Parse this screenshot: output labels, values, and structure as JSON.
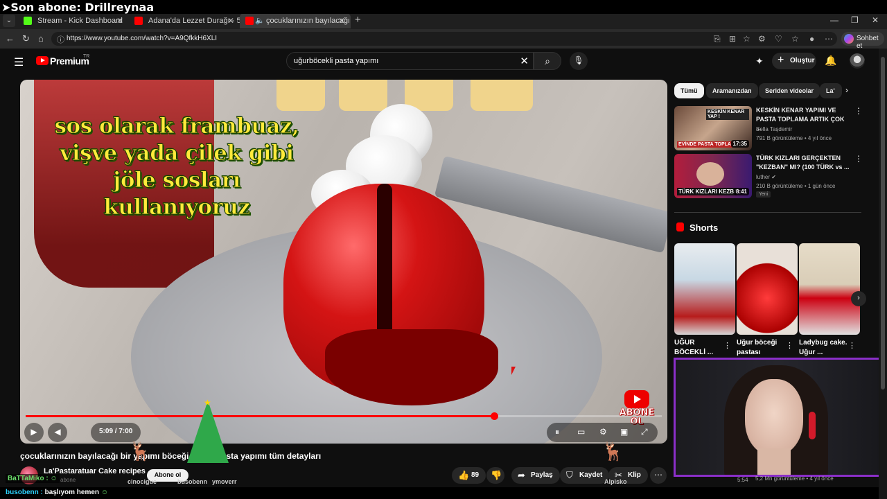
{
  "stream_overlay": {
    "last_sub": "➤Son abone: Drillreynaa"
  },
  "browser": {
    "tabs": [
      {
        "label": "Stream - Kick Dashboard",
        "favicon_color": "#53fc18"
      },
      {
        "label": "Adana'da Lezzet Durağı - 5. Bölüm",
        "favicon_color": "#ff0000"
      },
      {
        "label": "çocuklarınızın bayılacağı bir p",
        "favicon_color": "#ff0000"
      }
    ],
    "url": "https://www.youtube.com/watch?v=A9QfkkH6XLI",
    "copilot_label": "Sohbet et"
  },
  "youtube": {
    "logo_text": "Premium",
    "country_code": "TR",
    "search_query": "uğurböcekli pasta yapımı",
    "create_label": "Oluştur"
  },
  "video": {
    "subtitle_lines": [
      "sos olarak frambuaz,",
      "vişve yada çilek gibi",
      "jöle sosları kullanıyoruz"
    ],
    "current_time": "5:09",
    "duration": "7:00",
    "time_display": "5:09 / 7:00",
    "progress_fraction": 0.736,
    "badge_text_1": "ABONE",
    "badge_text_2": "OL",
    "title": "çocuklarınızın bayılacağı bir yapımı böceği şekilli pasta yapımı tüm detayları",
    "channel": "La'Pastaratuar Cake recipes",
    "channel_subs": "abone",
    "subscribe_label": "Abone ol",
    "likes": "89",
    "share_label": "Paylaş",
    "save_label": "Kaydet",
    "clip_label": "Klip"
  },
  "overlay_names": [
    "cinocigue",
    "busobenn",
    "ymoverr",
    "Alpisko"
  ],
  "chat": [
    {
      "user": "BaTTaMiko :",
      "message": ""
    },
    {
      "user": "busobenn :",
      "message": "başlıyom hemen"
    }
  ],
  "sidebar": {
    "chips": [
      "Tümü",
      "Aramanızdan",
      "Seriden videolar",
      "La'"
    ],
    "related": [
      {
        "title": "KESKİN KENAR YAPIMI VE PASTA TOPLAMA ARTIK ÇOK ...",
        "channel": "Bella Taşdemir",
        "meta": "791 B görüntüleme • 4 yıl önce",
        "duration": "17:35",
        "thumb_caption_top": "KESKİN KENAR YAP !",
        "thumb_caption_bottom": "EVİNDE PASTA TOPLA"
      },
      {
        "title": "TÜRK KIZLARI GERÇEKTEN \"KEZBAN\" MI? (100 TÜRK vs ...",
        "channel": "luther",
        "meta": "210 B görüntüleme • 1 gün önce",
        "duration": "8:41",
        "badge": "Yeni",
        "thumb_caption_bottom": "TÜRK KIZLARI KEZBAN(I) MI?"
      }
    ],
    "shorts_heading": "Shorts",
    "shorts": [
      {
        "title": "UĞUR BÖCEKLİ ..."
      },
      {
        "title": "Uğur böceği pastası"
      },
      {
        "title": "Ladybug cake. Uğur ..."
      }
    ],
    "bottom_meta": "5:54",
    "bottom_meta_2": "5,2 Mn görüntüleme • 4 yıl önce"
  }
}
